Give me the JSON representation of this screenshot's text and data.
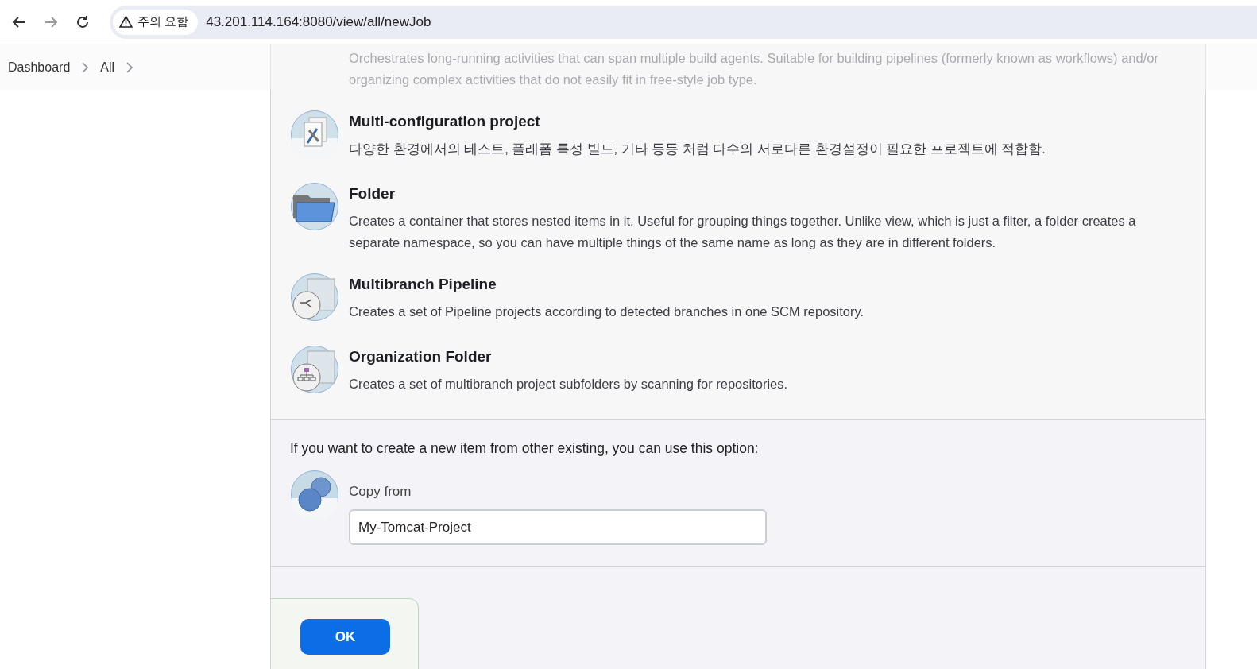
{
  "browser": {
    "security_badge": "주의 요함",
    "url": "43.201.114.164:8080/view/all/newJob"
  },
  "breadcrumbs": [
    {
      "label": "Dashboard"
    },
    {
      "label": "All"
    }
  ],
  "items": [
    {
      "kind": "faded",
      "description": "Orchestrates long-running activities that can span multiple build agents. Suitable for building pipelines (formerly known as workflows) and/or organizing complex activities that do not easily fit in free-style job type."
    },
    {
      "kind": "multiconfig",
      "title": "Multi-configuration project",
      "description": "다양한 환경에서의 테스트, 플래폼 특성 빌드, 기타 등등 처럼 다수의 서로다른 환경설정이 필요한 프로젝트에 적합함."
    },
    {
      "kind": "folder",
      "title": "Folder",
      "description": "Creates a container that stores nested items in it. Useful for grouping things together. Unlike view, which is just a filter, a folder creates a separate namespace, so you can have multiple things of the same name as long as they are in different folders."
    },
    {
      "kind": "multibranch",
      "title": "Multibranch Pipeline",
      "description": "Creates a set of Pipeline projects according to detected branches in one SCM repository."
    },
    {
      "kind": "organization",
      "title": "Organization Folder",
      "description": "Creates a set of multibranch project subfolders by scanning for repositories."
    }
  ],
  "copy": {
    "prompt": "If you want to create a new item from other existing, you can use this option:",
    "label": "Copy from",
    "value": "My-Tomcat-Project"
  },
  "ok_button": "OK"
}
